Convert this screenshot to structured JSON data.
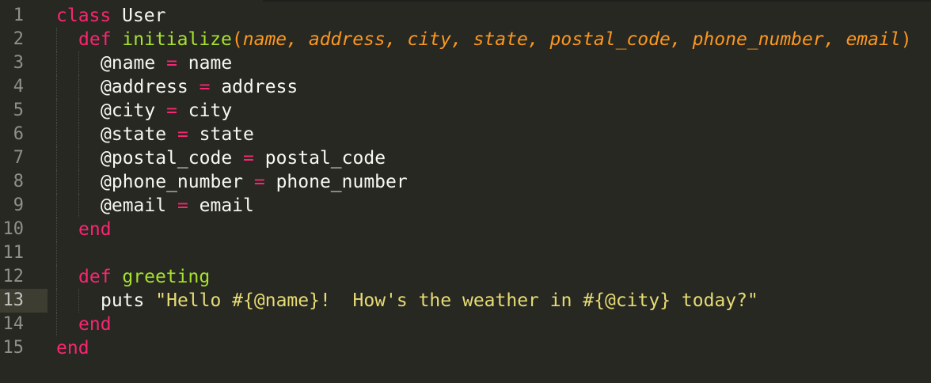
{
  "editor": {
    "theme_colors": {
      "background": "#272822",
      "keyword": "#f92672",
      "function": "#a6e22e",
      "parameter": "#fd971f",
      "string": "#e6db74",
      "text": "#f8f8f2",
      "line_number": "#8f908a"
    },
    "current_line": 13,
    "lines": [
      {
        "number": "1",
        "t": {
          "kw": "class",
          "sp": " ",
          "name": "User"
        }
      },
      {
        "number": "2",
        "t": {
          "kw": "def",
          "sp": " ",
          "fn": "initialize",
          "open": "(",
          "p1": "name",
          "c1": ", ",
          "p2": "address",
          "c2": ", ",
          "p3": "city",
          "c3": ", ",
          "p4": "state",
          "c4": ", ",
          "p5": "postal_code",
          "c5": ", ",
          "p6": "phone_number",
          "c6": ", ",
          "p7": "email",
          "close": ")"
        }
      },
      {
        "number": "3",
        "t": {
          "lhs": "@name",
          "eq": " = ",
          "rhs": "name"
        }
      },
      {
        "number": "4",
        "t": {
          "lhs": "@address",
          "eq": " = ",
          "rhs": "address"
        }
      },
      {
        "number": "5",
        "t": {
          "lhs": "@city",
          "eq": " = ",
          "rhs": "city"
        }
      },
      {
        "number": "6",
        "t": {
          "lhs": "@state",
          "eq": " = ",
          "rhs": "state"
        }
      },
      {
        "number": "7",
        "t": {
          "lhs": "@postal_code",
          "eq": " = ",
          "rhs": "postal_code"
        }
      },
      {
        "number": "8",
        "t": {
          "lhs": "@phone_number",
          "eq": " = ",
          "rhs": "phone_number"
        }
      },
      {
        "number": "9",
        "t": {
          "lhs": "@email",
          "eq": " = ",
          "rhs": "email"
        }
      },
      {
        "number": "10",
        "t": {
          "kw": "end"
        }
      },
      {
        "number": "11",
        "t": {}
      },
      {
        "number": "12",
        "t": {
          "kw": "def",
          "sp": " ",
          "fn": "greeting"
        }
      },
      {
        "number": "13",
        "t": {
          "call": "puts",
          "sp": " ",
          "str": "\"Hello #{@name}!  How's the weather in #{@city} today?\""
        }
      },
      {
        "number": "14",
        "t": {
          "kw": "end"
        }
      },
      {
        "number": "15",
        "t": {
          "kw": "end"
        }
      }
    ]
  }
}
